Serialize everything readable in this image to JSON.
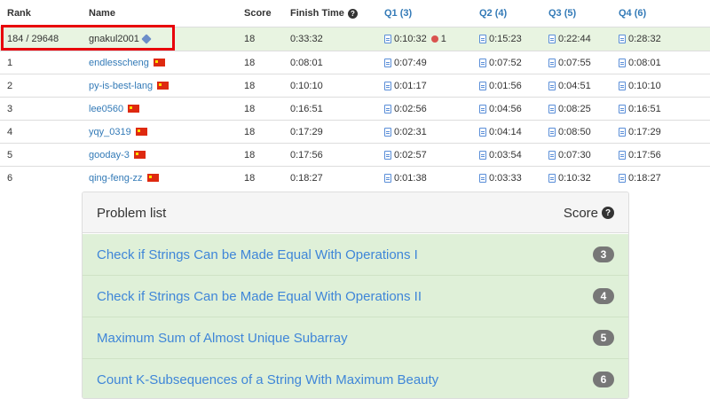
{
  "table": {
    "headers": {
      "rank": "Rank",
      "name": "Name",
      "score": "Score",
      "finish": "Finish Time",
      "q1": "Q1 (3)",
      "q2": "Q2 (4)",
      "q3": "Q3 (5)",
      "q4": "Q4 (6)"
    },
    "me": {
      "rank": "184 / 29648",
      "name": "gnakul2001",
      "score": "18",
      "finish": "0:33:32",
      "q1": "0:10:32",
      "q1_penalty": "1",
      "q2": "0:15:23",
      "q3": "0:22:44",
      "q4": "0:28:32"
    },
    "rows": [
      {
        "rank": "1",
        "name": "endlesscheng",
        "score": "18",
        "finish": "0:08:01",
        "q1": "0:07:49",
        "q2": "0:07:52",
        "q3": "0:07:55",
        "q4": "0:08:01"
      },
      {
        "rank": "2",
        "name": "py-is-best-lang",
        "score": "18",
        "finish": "0:10:10",
        "q1": "0:01:17",
        "q2": "0:01:56",
        "q3": "0:04:51",
        "q4": "0:10:10"
      },
      {
        "rank": "3",
        "name": "lee0560",
        "score": "18",
        "finish": "0:16:51",
        "q1": "0:02:56",
        "q2": "0:04:56",
        "q3": "0:08:25",
        "q4": "0:16:51"
      },
      {
        "rank": "4",
        "name": "yqy_0319",
        "score": "18",
        "finish": "0:17:29",
        "q1": "0:02:31",
        "q2": "0:04:14",
        "q3": "0:08:50",
        "q4": "0:17:29"
      },
      {
        "rank": "5",
        "name": "gooday-3",
        "score": "18",
        "finish": "0:17:56",
        "q1": "0:02:57",
        "q2": "0:03:54",
        "q3": "0:07:30",
        "q4": "0:17:56"
      },
      {
        "rank": "6",
        "name": "qing-feng-zz",
        "score": "18",
        "finish": "0:18:27",
        "q1": "0:01:38",
        "q2": "0:03:33",
        "q3": "0:10:32",
        "q4": "0:18:27"
      }
    ]
  },
  "problems": {
    "title": "Problem list",
    "score_label": "Score",
    "items": [
      {
        "title": "Check if Strings Can be Made Equal With Operations I",
        "score": "3"
      },
      {
        "title": "Check if Strings Can be Made Equal With Operations II",
        "score": "4"
      },
      {
        "title": "Maximum Sum of Almost Unique Subarray",
        "score": "5"
      },
      {
        "title": "Count K-Subsequences of a String With Maximum Beauty",
        "score": "6"
      }
    ]
  },
  "icons": {
    "help": "question-circle-icon",
    "solution": "file-icon",
    "penalty": "bug-icon",
    "flag": "china-flag-icon",
    "badge": "gem-icon"
  },
  "colors": {
    "link": "#337ab7",
    "row_highlight": "#e8f4e1",
    "problem_bg": "#dff0d8",
    "highlight_box": "#e8000b",
    "badge": "#777777"
  }
}
